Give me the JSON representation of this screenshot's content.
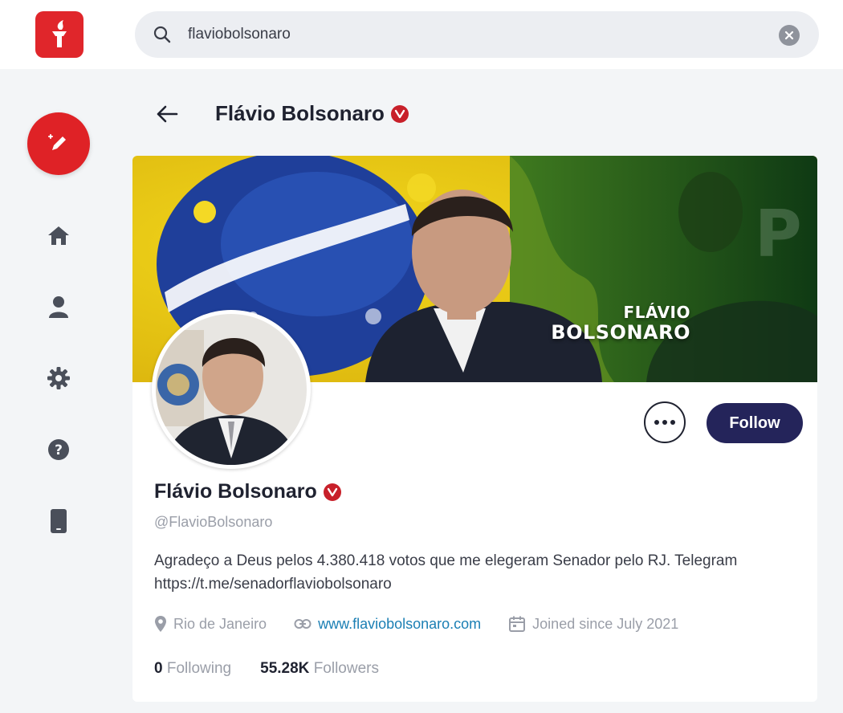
{
  "search": {
    "value": "flaviobolsonaro"
  },
  "header": {
    "title": "Flávio Bolsonaro"
  },
  "banner": {
    "line1": "FLÁVIO",
    "line2": "BOLSONARO"
  },
  "profile": {
    "name": "Flávio Bolsonaro",
    "handle": "@FlavioBolsonaro",
    "bio": "Agradeço a Deus pelos 4.380.418 votos que me elegeram Senador pelo RJ. Telegram https://t.me/senadorflaviobolsonaro",
    "location": "Rio de Janeiro",
    "website": "www.flaviobolsonaro.com",
    "joined": "Joined since July 2021",
    "following_count": "0",
    "following_label": "Following",
    "followers_count": "55.28K",
    "followers_label": "Followers"
  },
  "actions": {
    "follow": "Follow"
  },
  "colors": {
    "brand": "#e0262b",
    "follow_bg": "#24245a",
    "link": "#1b7fb4"
  }
}
